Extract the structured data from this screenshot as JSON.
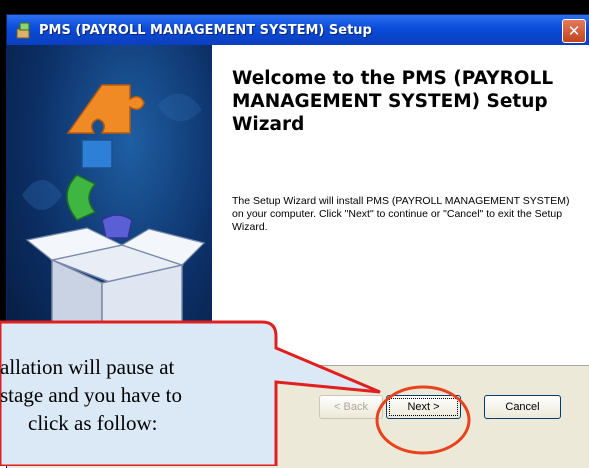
{
  "window": {
    "title": "PMS (PAYROLL MANAGEMENT SYSTEM) Setup",
    "close_label": "✕"
  },
  "content": {
    "heading": "Welcome to the PMS (PAYROLL MANAGEMENT SYSTEM) Setup Wizard",
    "description": "The Setup Wizard will install PMS (PAYROLL MANAGEMENT SYSTEM) on your computer. Click \"Next\" to continue or \"Cancel\" to exit the Setup Wizard."
  },
  "buttons": {
    "back": "< Back",
    "next": "Next >",
    "cancel": "Cancel"
  },
  "callout": {
    "line1": "allation will pause at",
    "line2": "stage and you have to",
    "line3": "click as follow:"
  },
  "colors": {
    "callout_fill": "#dbe9f7",
    "callout_border": "#e02020",
    "highlight_ring": "#e8431c"
  }
}
